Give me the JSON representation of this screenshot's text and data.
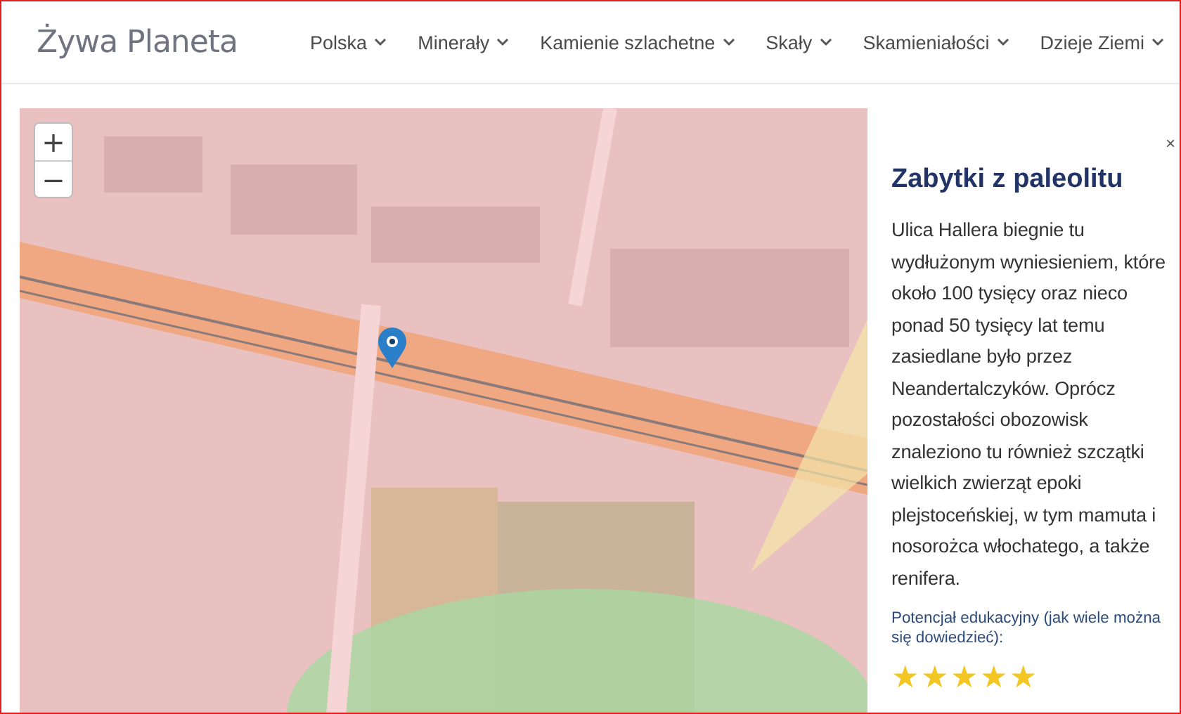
{
  "site": {
    "title": "Żywa Planeta"
  },
  "nav": [
    {
      "label": "Polska"
    },
    {
      "label": "Minerały"
    },
    {
      "label": "Kamienie szlachetne"
    },
    {
      "label": "Skały"
    },
    {
      "label": "Skamieniałości"
    },
    {
      "label": "Dzieje Ziemi"
    }
  ],
  "map": {
    "zoom_in": "+",
    "zoom_out": "−"
  },
  "panel": {
    "close": "×",
    "title": "Zabytki z paleolitu",
    "text": "Ulica Hallera biegnie tu wydłużonym wyniesieniem, które około 100 tysięcy oraz nieco ponad 50 tysięcy lat temu zasiedlane było przez Neandertalczyków. Oprócz pozostałości obozowisk znaleziono tu również szczątki wielkich zwierząt epoki plejstoceńskiej, w tym mamuta i nosorożca włochatego, a także renifera.",
    "rating_label": "Potencjał edukacyjny (jak wiele można się dowiedzieć):",
    "stars": 5
  }
}
